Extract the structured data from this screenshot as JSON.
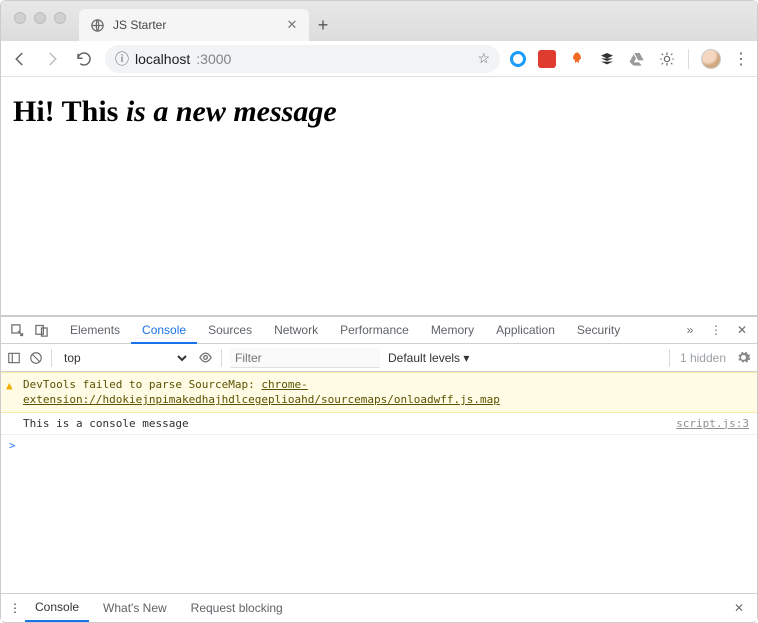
{
  "window": {
    "tab_title": "JS Starter"
  },
  "addressbar": {
    "info_icon": "ⓘ",
    "host": "localhost",
    "port": ":3000"
  },
  "page": {
    "heading_plain": "Hi! This ",
    "heading_italic": "is a new message"
  },
  "devtools": {
    "tabs": {
      "elements": "Elements",
      "console": "Console",
      "sources": "Sources",
      "network": "Network",
      "performance": "Performance",
      "memory": "Memory",
      "application": "Application",
      "security": "Security"
    },
    "toolbar": {
      "context": "top",
      "filter_placeholder": "Filter",
      "levels": "Default levels ▾",
      "hidden": "1 hidden"
    },
    "console": {
      "warning_prefix": "DevTools failed to parse SourceMap: ",
      "warning_link": "chrome-extension://hdokiejnpimakedhajhdlcegeplioahd/sourcemaps/onloadwff.js.map",
      "log_message": "This is a console message",
      "log_source": "script.js:3",
      "prompt": ">"
    },
    "drawer": {
      "console": "Console",
      "whatsnew": "What's New",
      "request_blocking": "Request blocking"
    }
  }
}
